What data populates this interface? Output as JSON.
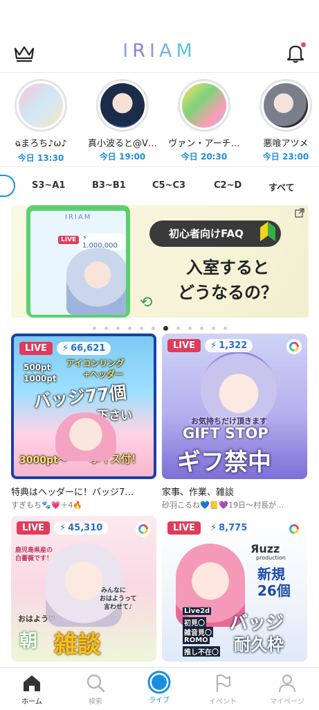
{
  "header": {
    "logo_letters": [
      "I",
      "R",
      "I",
      "A",
      "M"
    ]
  },
  "schedule": [
    {
      "name": "ฉまろち♪ω♪",
      "time": "今日 13:30"
    },
    {
      "name": "真小波ると@V…",
      "time": "今日 19:00"
    },
    {
      "name": "ヴァン・アーチ…",
      "time": "今日 20:30"
    },
    {
      "name": "悪喰アツメ",
      "time": "今日 23:00"
    }
  ],
  "ranks": [
    "S3~A1",
    "B3~B1",
    "C5~C3",
    "C2~D",
    "すべて"
  ],
  "banner": {
    "faq": "初心者向けFAQ",
    "title_line1": "入室すると",
    "title_line2": "どうなるの？",
    "phone_logo": "IRIAM",
    "phone_live": "LIVE",
    "phone_count": "⚡ 1,000,000"
  },
  "carousel": {
    "count": 12,
    "active": 7
  },
  "cards": [
    {
      "live": "LIVE",
      "viewers": "66,621",
      "title": "特典はヘッダーに！バッジ7…",
      "sub": "すぎもち🐾💗＋4🔥",
      "thumb_text": [
        "500pt",
        "1000pt",
        "アイコンリング",
        "+ヘッダー",
        "バッジ77個",
        "下さい",
        "3000pt〜",
        "ボイス付！"
      ]
    },
    {
      "live": "LIVE",
      "viewers": "1,322",
      "title": "家事、作業、雑談",
      "sub": "砂羽こるね💙📒💜19日〜村長が…",
      "thumb_text": [
        "お気持ちだけ頂きます",
        "GIFT STOP",
        "ギフ禁中"
      ]
    },
    {
      "live": "LIVE",
      "viewers": "45,310",
      "title": "",
      "sub": "",
      "thumb_text": [
        "鹿児島県産の",
        "白薔薇です！",
        "みんなに",
        "おはようって",
        "言わせて♪",
        "おはよう♡",
        "朝",
        "雑談"
      ]
    },
    {
      "live": "LIVE",
      "viewers": "8,775",
      "title": "",
      "sub": "",
      "thumb_text": [
        "Яuzz",
        "production",
        "新規",
        "26個",
        "Live2d",
        "初見〇",
        "雑音見〇",
        "ROMO",
        "推し不在〇",
        "バッジ",
        "耐久枠"
      ]
    }
  ],
  "tabs": [
    {
      "label": "ホーム",
      "icon": "home-icon"
    },
    {
      "label": "検索",
      "icon": "search-icon"
    },
    {
      "label": "ライブ",
      "icon": "live-icon"
    },
    {
      "label": "イベント",
      "icon": "flag-icon"
    },
    {
      "label": "マイページ",
      "icon": "person-icon"
    }
  ],
  "colors": {
    "accent": "#1a8fe0",
    "live": "#e23a5a",
    "notification": "#f0446b"
  }
}
